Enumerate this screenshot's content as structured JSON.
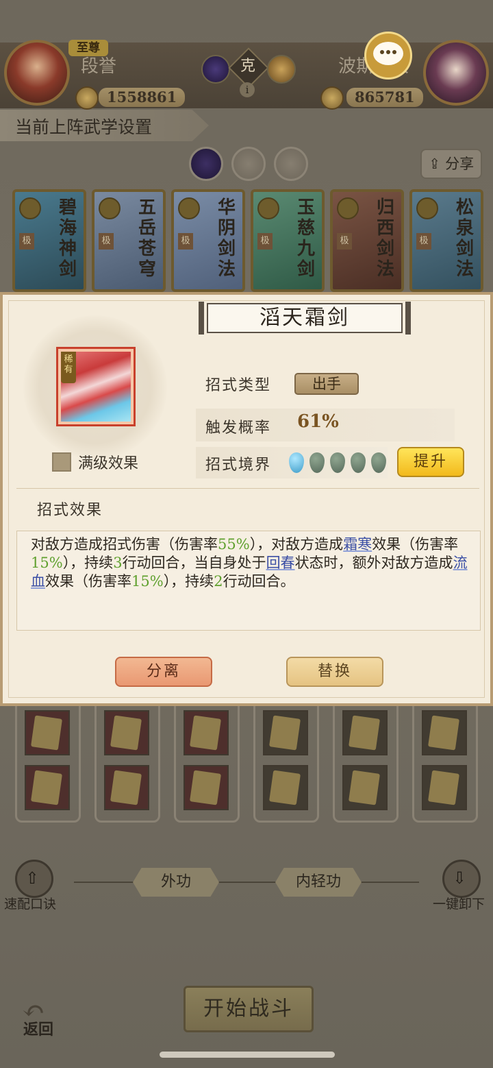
{
  "header": {
    "left_player": {
      "badge": "至尊",
      "name": "段誉",
      "power": "1558861"
    },
    "right_player": {
      "name": "波斯圣女",
      "power": "865781"
    },
    "vs_label": "克",
    "info_label": "i"
  },
  "setup": {
    "section_title": "当前上阵武学设置",
    "share_label": "分享"
  },
  "cards": [
    {
      "title": "碧海神剑",
      "level": "极"
    },
    {
      "title": "五岳苍穹",
      "level": "极"
    },
    {
      "title": "华阴剑法",
      "level": "极"
    },
    {
      "title": "玉慈九剑",
      "level": "极"
    },
    {
      "title": "归西剑法",
      "level": "极"
    },
    {
      "title": "松泉剑法",
      "level": "极"
    }
  ],
  "modal": {
    "skill_name": "滔天霜剑",
    "rarity_tag": "稀有",
    "max_level_label": "满级效果",
    "type_label": "招式类型",
    "type_value": "出手",
    "prob_label": "触发概率",
    "prob_value": "61%",
    "realm_label": "招式境界",
    "realm_level": 1,
    "realm_max": 5,
    "upgrade_label": "提升",
    "effect_heading": "招式效果",
    "effect": {
      "p1": "对敌方造成招式伤害（伤害率",
      "v1": "55%",
      "p2": "），对敌方造成",
      "k1": "霜寒",
      "p3": "效果（伤害率",
      "v2": "15%",
      "p4": "），持续",
      "v3": "3",
      "p5": "行动回合，当自身处于",
      "k2": "回春",
      "p6": "状态时，额外对敌方造成",
      "k3": "流血",
      "p7": "效果（伤害率",
      "v4": "15%",
      "p8": "），持续",
      "v5": "2",
      "p9": "行动回合。"
    },
    "separate_label": "分离",
    "replace_label": "替换"
  },
  "footer": {
    "tab_outer": "外功",
    "tab_inner": "内轻功",
    "quick_label": "速配口诀",
    "unload_label": "一键卸下",
    "start_label": "开始战斗",
    "back_label": "返回"
  },
  "colors": {
    "accent_green": "#5fa02e",
    "keyword_blue": "#3b4fa5",
    "upgrade_yellow": "#f2b91c"
  }
}
